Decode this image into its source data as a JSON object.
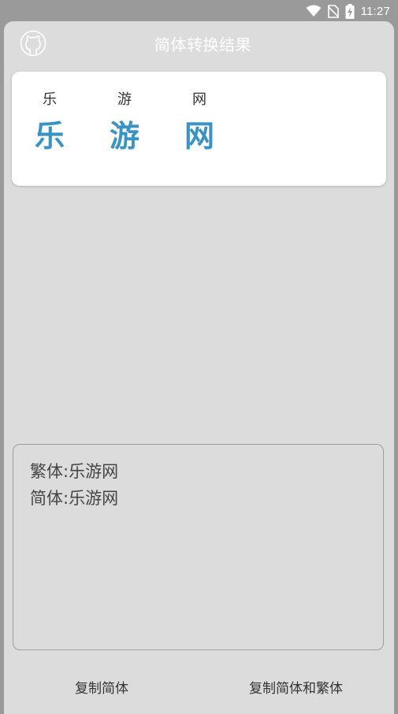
{
  "status_bar": {
    "time": "11:27",
    "icons": [
      "wifi-icon",
      "no-sim-icon",
      "battery-charging-icon"
    ]
  },
  "header": {
    "title": "简体转换结果",
    "icon": "github-icon"
  },
  "characters": [
    {
      "small": "乐",
      "big": "乐"
    },
    {
      "small": "游",
      "big": "游"
    },
    {
      "small": "网",
      "big": "网"
    }
  ],
  "result": {
    "traditional_line": "繁体:乐游网",
    "simplified_line": "简体:乐游网"
  },
  "buttons": {
    "copy_simplified": "复制简体",
    "copy_both": "复制简体和繁体"
  },
  "colors": {
    "accent": "#3a93c3",
    "sheet_bg": "#dcdcdc",
    "status_bg": "#9a9a9a"
  }
}
